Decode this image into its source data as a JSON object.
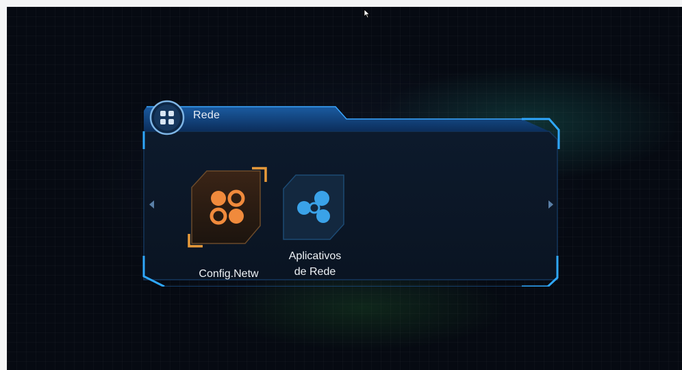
{
  "window": {
    "title": "Rede"
  },
  "items": [
    {
      "label": "Config.Netw",
      "selected": true
    },
    {
      "label_line1": "Aplicativos",
      "label_line2": "de Rede",
      "selected": false
    }
  ],
  "icons": {
    "header": "grid-menu-icon",
    "item1": "network-config-icon",
    "item2": "network-apps-icon",
    "nav_left": "arrow-left-icon",
    "nav_right": "arrow-right-icon",
    "cursor": "mouse-cursor-icon"
  },
  "colors": {
    "accent_blue": "#1e8fd8",
    "selected_orange": "#e08a3a",
    "item_blue": "#2a8fd0"
  }
}
